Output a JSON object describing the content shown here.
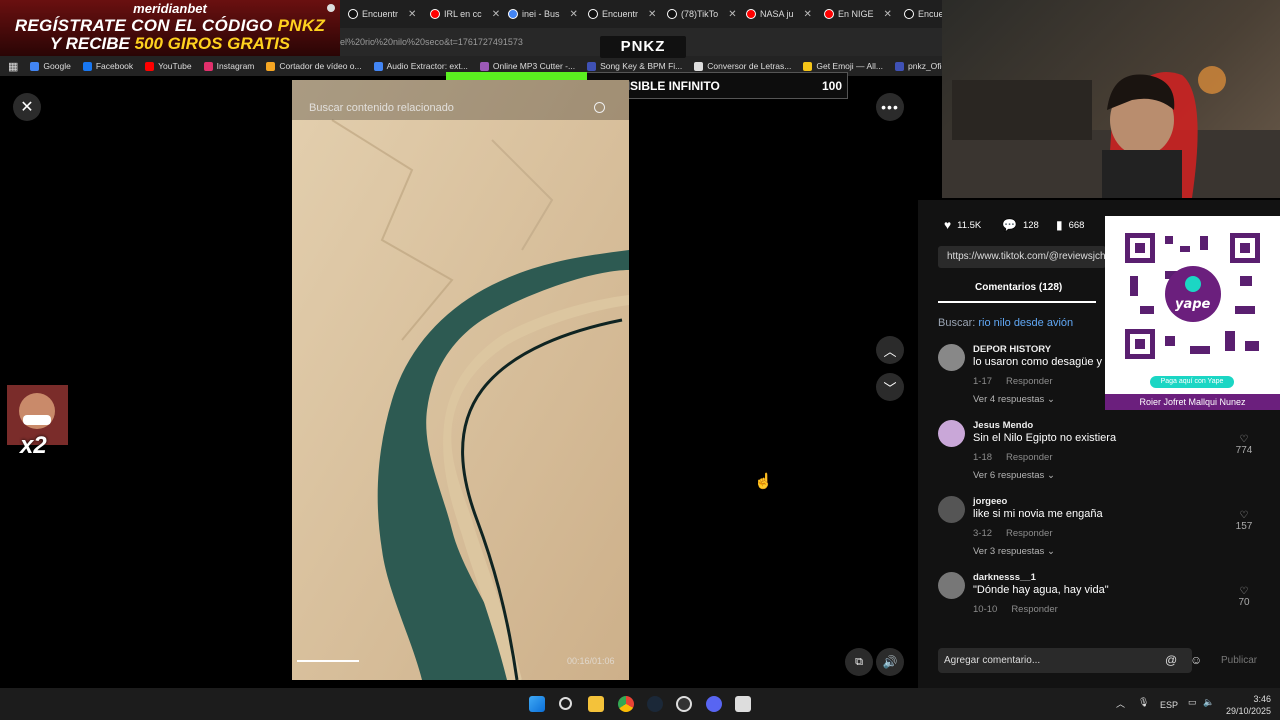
{
  "ad": {
    "brand": "meridianbet",
    "line1": "REGÍSTRATE CON EL CÓDIGO",
    "code": "PNKZ",
    "line2_a": "Y RECIBE",
    "line2_b": "500 GIROS GRATIS"
  },
  "tabs": [
    {
      "label": "Encuentr",
      "icon": "tiktok-icon"
    },
    {
      "label": "IRL en cc",
      "icon": "youtube-icon"
    },
    {
      "label": "inei - Bus",
      "icon": "google-icon"
    },
    {
      "label": "Encuentr",
      "icon": "tiktok-icon"
    },
    {
      "label": "(78)TikTo",
      "icon": "tiktok-icon"
    },
    {
      "label": "NASA ju",
      "icon": "youtube-icon"
    },
    {
      "label": "En NIGE",
      "icon": "youtube-icon"
    },
    {
      "label": "Encuer",
      "icon": "tiktok-icon"
    }
  ],
  "address": {
    "url": "el%20rio%20nilo%20seco&t=1761727491573"
  },
  "bookmarks": [
    {
      "label": "Google"
    },
    {
      "label": "Facebook"
    },
    {
      "label": "YouTube"
    },
    {
      "label": "Instagram"
    },
    {
      "label": "Cortador de vídeo o..."
    },
    {
      "label": "Audio Extractor: ext..."
    },
    {
      "label": "Online MP3 Cutter -..."
    },
    {
      "label": "Song Key & BPM Fi..."
    },
    {
      "label": "Conversor de Letras..."
    },
    {
      "label": "Get Emoji — All..."
    },
    {
      "label": "pnkz_Oficial"
    }
  ],
  "logo": "PNKZ",
  "subgoal": {
    "current": "35",
    "title": "EXTENSIBLE INFINITO",
    "max": "100",
    "progress": 0.35
  },
  "video": {
    "search_placeholder": "Buscar contenido relacionado",
    "time": "00:16/01:06"
  },
  "stats": {
    "likes": "11.5K",
    "comments": "128",
    "saves": "668"
  },
  "link": "https://www.tiktok.com/@reviewsjch",
  "comments_tab": "Comentarios (128)",
  "search": {
    "prefix": "Buscar:",
    "query": "rio nilo desde avión"
  },
  "comments": [
    {
      "user": "DEPOR HISTORY",
      "text": "lo usaron como desagüe y",
      "date": "1-17",
      "reply": "Responder",
      "replies": "Ver 4 respuestas",
      "likes": ""
    },
    {
      "user": "Jesus Mendo",
      "text": "Sin el Nilo Egipto no existiera",
      "date": "1-18",
      "reply": "Responder",
      "replies": "Ver 6 respuestas",
      "likes": "774"
    },
    {
      "user": "jorgeeo",
      "text": "like si mi novia me engaña",
      "date": "3-12",
      "reply": "Responder",
      "replies": "Ver 3 respuestas",
      "likes": "157"
    },
    {
      "user": "darknesss__1",
      "text": "\"Dónde hay agua, hay vida\"",
      "date": "10-10",
      "reply": "Responder",
      "replies": "",
      "likes": "70"
    }
  ],
  "add_comment": {
    "placeholder": "Agregar comentario...",
    "publish": "Publicar"
  },
  "qr": {
    "pill": "Paga aquí con Yape",
    "name": "Roier Jofret Mallqui Nunez"
  },
  "emote": {
    "label": "x2"
  },
  "taskbar": {
    "lang": "ESP",
    "time": "3:46",
    "date": "29/10/2025"
  }
}
